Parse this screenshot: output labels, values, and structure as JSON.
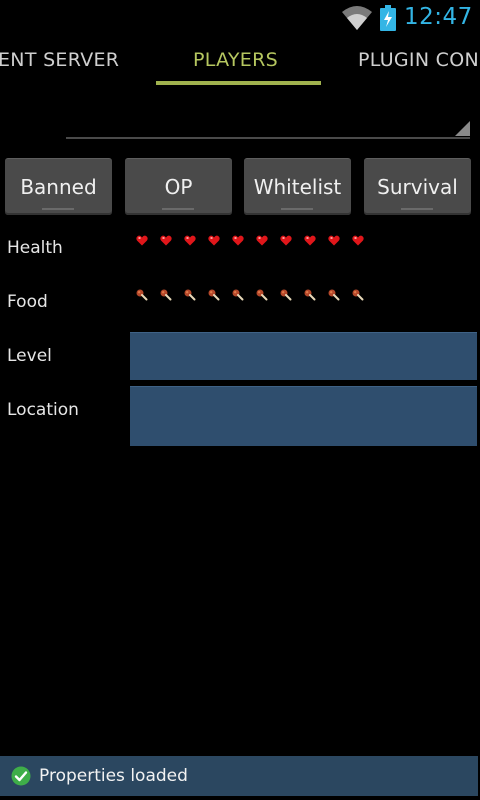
{
  "status_bar": {
    "time": "12:47",
    "wifi_icon": "wifi-icon",
    "battery_icon": "battery-charging-icon",
    "clock_color": "#33b5e5"
  },
  "tabs": [
    {
      "label": "ENT SERVER",
      "selected": false
    },
    {
      "label": "PLAYERS",
      "selected": true
    },
    {
      "label": "PLUGIN CON",
      "selected": false
    }
  ],
  "accent_color": "#a0b24e",
  "spinner": {
    "value": "",
    "arrow_icon": "spinner-arrow-icon"
  },
  "buttons": {
    "banned": "Banned",
    "op": "OP",
    "whitelist": "Whitelist",
    "gamemode": "Survival"
  },
  "player": {
    "health_label": "Health",
    "health_icon": "heart-icon",
    "health_count": 10,
    "food_label": "Food",
    "food_icon": "drumstick-icon",
    "food_count": 10,
    "level_label": "Level",
    "level_value": "",
    "location_label": "Location",
    "location_value": "",
    "field_color": "#2f4e6e"
  },
  "toast": {
    "message": "Properties loaded",
    "icon": "check-circle-icon",
    "background": "#2b4760"
  }
}
